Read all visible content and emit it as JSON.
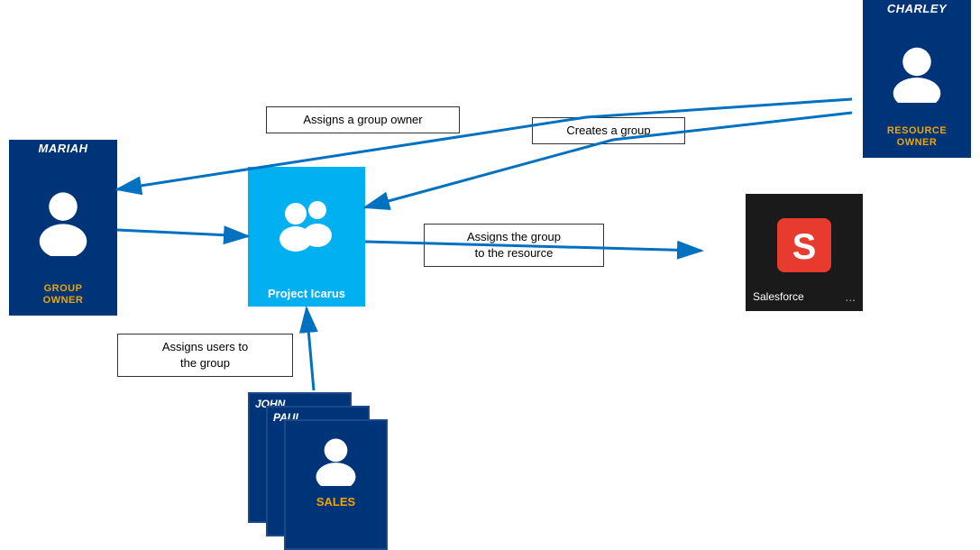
{
  "charley": {
    "name": "CHARLEY",
    "role": "RESOURCE\nOWNER"
  },
  "mariah": {
    "name": "MARIAH",
    "role": "GROUP\nOWNER"
  },
  "project_icarus": {
    "label": "Project Icarus"
  },
  "salesforce": {
    "label": "Salesforce",
    "dots": "..."
  },
  "users": [
    {
      "name": "JOHN"
    },
    {
      "name": "PAUL"
    },
    {
      "name": "SALES",
      "role": ""
    }
  ],
  "labels": {
    "assigns_group_owner": "Assigns a group owner",
    "creates_group": "Creates a group",
    "assigns_group_resource": "Assigns the group\nto the resource",
    "assigns_users": "Assigns users to\nthe group"
  }
}
